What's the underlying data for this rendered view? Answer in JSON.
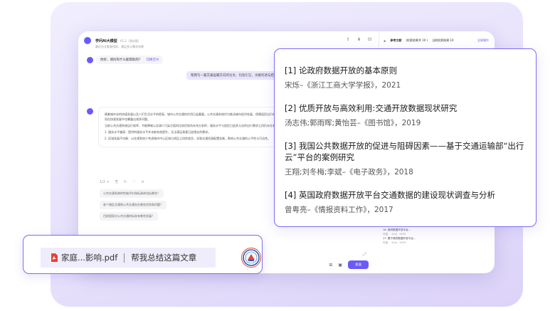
{
  "app": {
    "title": "学问AI大模型",
    "version": "V1.2（测试版）",
    "subtitle": "最优化文献查找库，满足多元需求场景",
    "header_icons": [
      "export-icon",
      "share-icon",
      "lock-icon"
    ]
  },
  "right_panel": {
    "title": "参考文献",
    "meta1": "(检索结果共 10 )",
    "meta2": "当前检索结果 10",
    "action": "全屏操作"
  },
  "chat": {
    "greeting": "你好，请问有什么能帮助的？",
    "greeting_link": "切换至AI",
    "user_message": "帮我写一篇交通运输方向的论文，包括引言，文献综述与结论",
    "answer_paragraphs": [
      "随着城市化的快速发展以及人们生活水平的提高，城市公共交通的作用日益重要。公共交通系统作为推动城市经济发展、保障居民出行的重要基础设施，对缓解交通压力、减少环境污染具有显著作用。然而在快速发展中也暴露出诸多问题。",
      "当前公共交通系统运行效率、节能降耗以及减少污染方面的比较优势尚未充分发挥，服务水平与居民日益多元化的出行需求之间仍存在差距，有必要从多维度进行研究。",
      "1. 服务水平偏高：提供的服务水平并未能有效提升，无法满足乘客日益增长的需求。",
      "2. 区域发展不均衡：以往规划较少考虑城市中心区域与郊区之间的差异，导致交通资源配置失衡，影响公共交通的公平性与可达性。"
    ],
    "answer_page": "1/2 >",
    "suggestions": [
      "公共交通系统的性能评价指标具体包括哪些？",
      "各个城区交通和公共交通存在哪些优势和问题？",
      "目前国家对公共交通的标准有哪些发展？"
    ],
    "send_label": "发送"
  },
  "refs_list": [
    {
      "title": "16. 政府数据开放平台...",
      "meta": "作者 · 《xx》 2020"
    },
    {
      "title": "17. 基于政府数据开放平台...",
      "meta": "作者 · 《xx》 2019"
    }
  ],
  "popup": {
    "references": [
      {
        "title": "[1] 论政府数据开放的基本原则",
        "meta": "宋烁–《浙江工商大学学报》，2021"
      },
      {
        "title": "[2] 优质开放与高效利用:交通开放数据现状研究",
        "meta": "汤志伟;郭雨晖;黄怡芸–《图书馆》，2019"
      },
      {
        "title": "[3] 我国公共数据开放的促进与阻碍因素——基于交通运输部“出行云”平台的案例研究",
        "meta": "王翔;刘冬梅;李斌–《电子政务》，2018"
      },
      {
        "title": "[4] 英国政府数据开放平台交通数据的建设现状调查与分析",
        "meta": "曾粤亮–《情报资料工作》，2017"
      }
    ]
  },
  "prompt": {
    "file_name": "家庭...影响.pdf",
    "question": "帮我总结这篇文章"
  },
  "colors": {
    "accent": "#6a5af9",
    "popup_border": "#7b6df5",
    "chip_bg": "#efedfb"
  }
}
